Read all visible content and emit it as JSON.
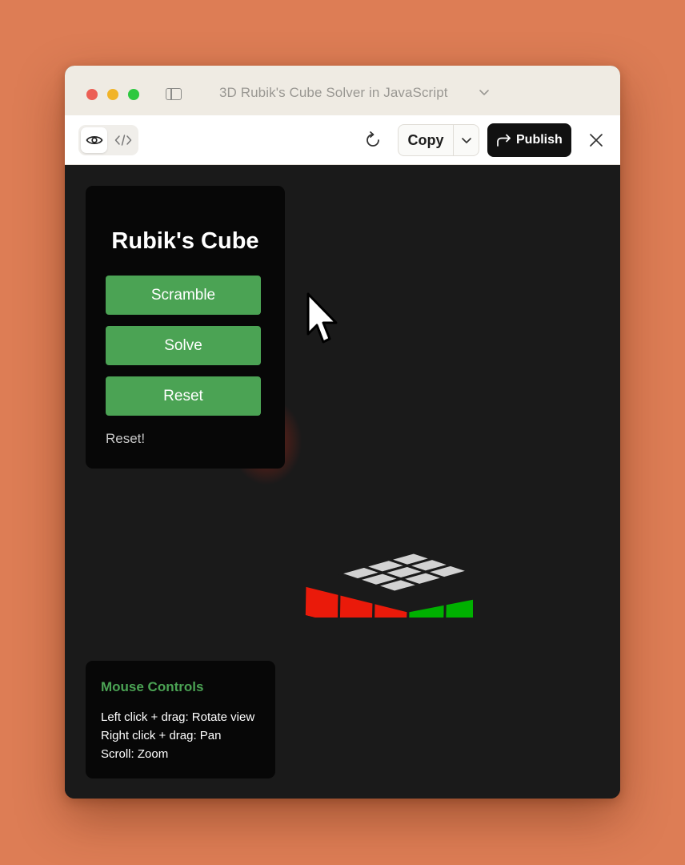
{
  "window": {
    "title": "3D Rubik's Cube Solver in JavaScript"
  },
  "toolbar": {
    "copy_label": "Copy",
    "publish_label": "Publish"
  },
  "controls": {
    "heading": "Rubik's Cube",
    "scramble_label": "Scramble",
    "solve_label": "Solve",
    "reset_label": "Reset",
    "status": "Reset!"
  },
  "help": {
    "title": "Mouse Controls",
    "lines": [
      "Left click + drag: Rotate view",
      "Right click + drag: Pan",
      "Scroll: Zoom"
    ]
  },
  "cube": {
    "faces": {
      "top": "white",
      "left": "red",
      "right": "green"
    },
    "colors": {
      "white": "#d2d2d2",
      "red": "#ea1a0a",
      "green": "#00b000",
      "edge": "#1a1a1a"
    }
  },
  "icons": {
    "sidebar": "sidebar-icon",
    "title_menu": "chevron-down-icon",
    "preview": "eye-icon",
    "code": "code-icon",
    "refresh": "refresh-icon",
    "copy_menu": "chevron-down-icon",
    "publish": "share-arrow-icon",
    "close": "close-icon",
    "pointer": "mouse-pointer-icon"
  },
  "theme": {
    "desktop": "#dd7d55",
    "titlebar": "#efebe3",
    "viewport": "#1a1a1a",
    "panel": "#070707",
    "accent_green": "#4ba354"
  }
}
